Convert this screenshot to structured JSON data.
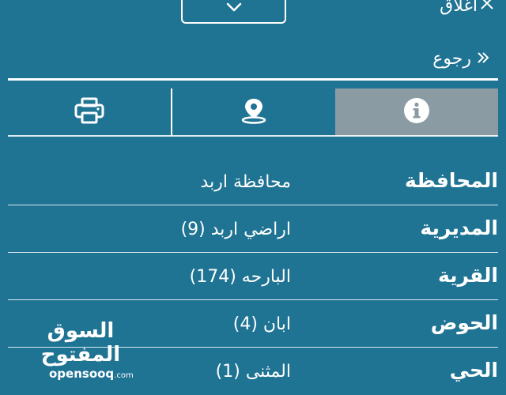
{
  "header": {
    "close_label": "اغلاق",
    "close_icon": "close-x-icon",
    "dropdown_icon": "chevron-down-icon"
  },
  "back": {
    "label": "رجوع",
    "icon": "double-chevron-right-icon"
  },
  "tabs": [
    {
      "icon": "info-icon",
      "active": true
    },
    {
      "icon": "location-pin-icon",
      "active": false
    },
    {
      "icon": "printer-icon",
      "active": false
    }
  ],
  "details": [
    {
      "label": "المحافظة",
      "value": "محافظة اربد"
    },
    {
      "label": "المديرية",
      "value": "اراضي اربد (9)"
    },
    {
      "label": "القرية",
      "value": "البارحه (174)"
    },
    {
      "label": "الحوض",
      "value": "ابان (4)"
    },
    {
      "label": "الحي",
      "value": "المثنى (1)"
    }
  ],
  "watermark": {
    "arabic": "السوق المفتوح",
    "latin": "opensooq",
    "suffix": ".com"
  },
  "colors": {
    "background": "#1f7393",
    "active_tab": "#8a9ba4",
    "text": "#ffffff"
  }
}
